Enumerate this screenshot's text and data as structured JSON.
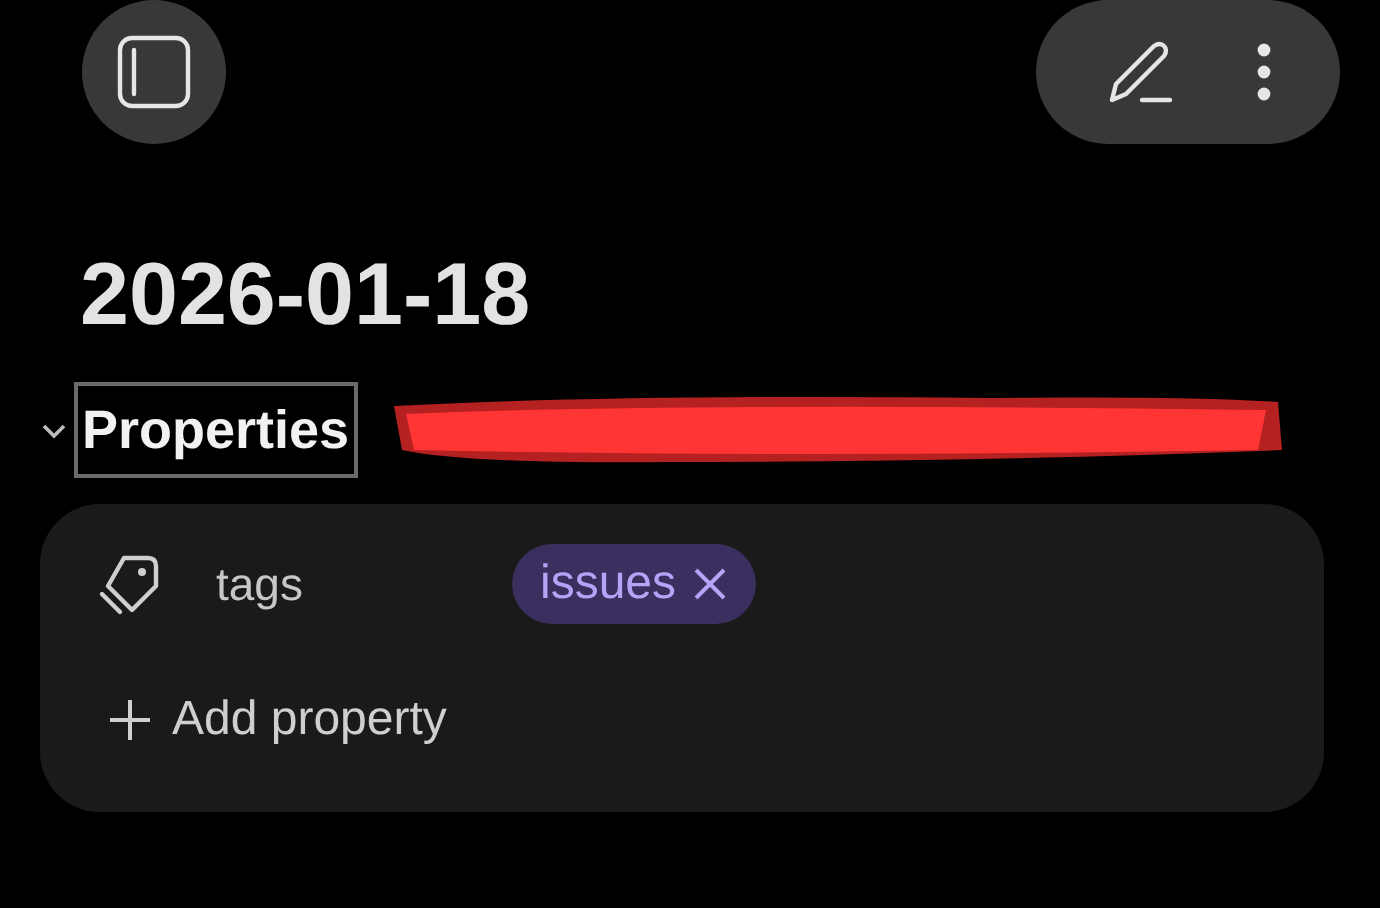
{
  "title": "2026-01-18",
  "properties": {
    "label": "Properties",
    "expanded": true,
    "items": [
      {
        "name": "tags",
        "values": [
          "issues"
        ]
      }
    ],
    "add_label": "Add property"
  }
}
